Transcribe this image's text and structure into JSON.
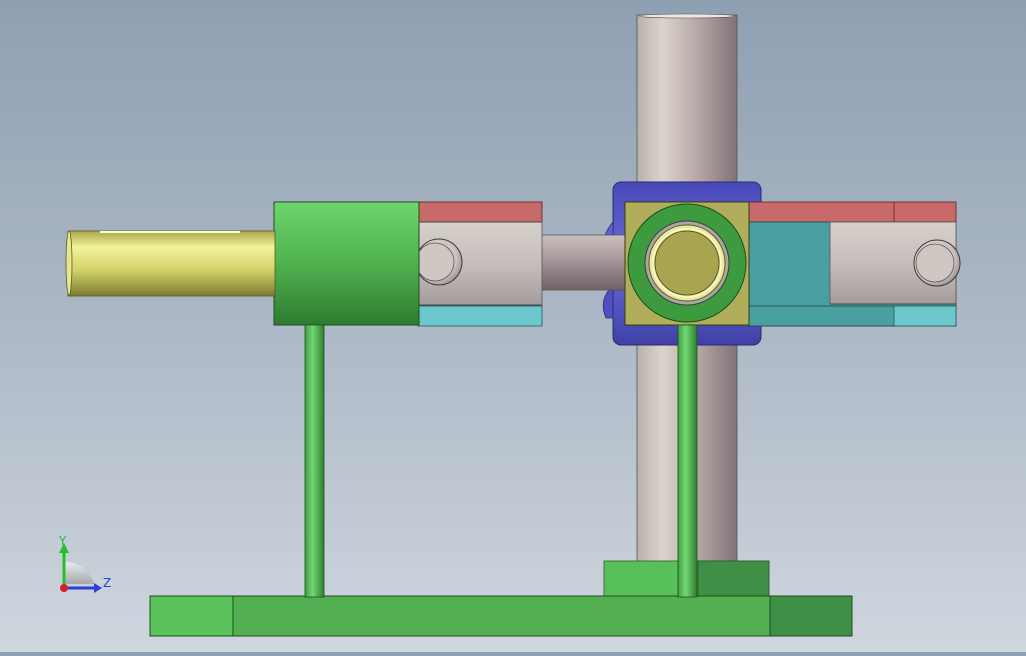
{
  "triad": {
    "y_label": "Y",
    "z_label": "Z",
    "y_color": "#22c02a",
    "z_color": "#2a3fd8",
    "x_color": "#d82020"
  },
  "colors": {
    "shaft_yellow": "#d8d870",
    "green_part": "#58c058",
    "green_dark": "#2f8a30",
    "red_band": "#c86a6a",
    "cyan_band": "#6cc8cc",
    "teal_block": "#4aa0a0",
    "blue_collar": "#5a5ac8",
    "olive_block": "#b0ae5a",
    "metal_light": "#d4cbc4",
    "metal_dark": "#8a8088"
  }
}
